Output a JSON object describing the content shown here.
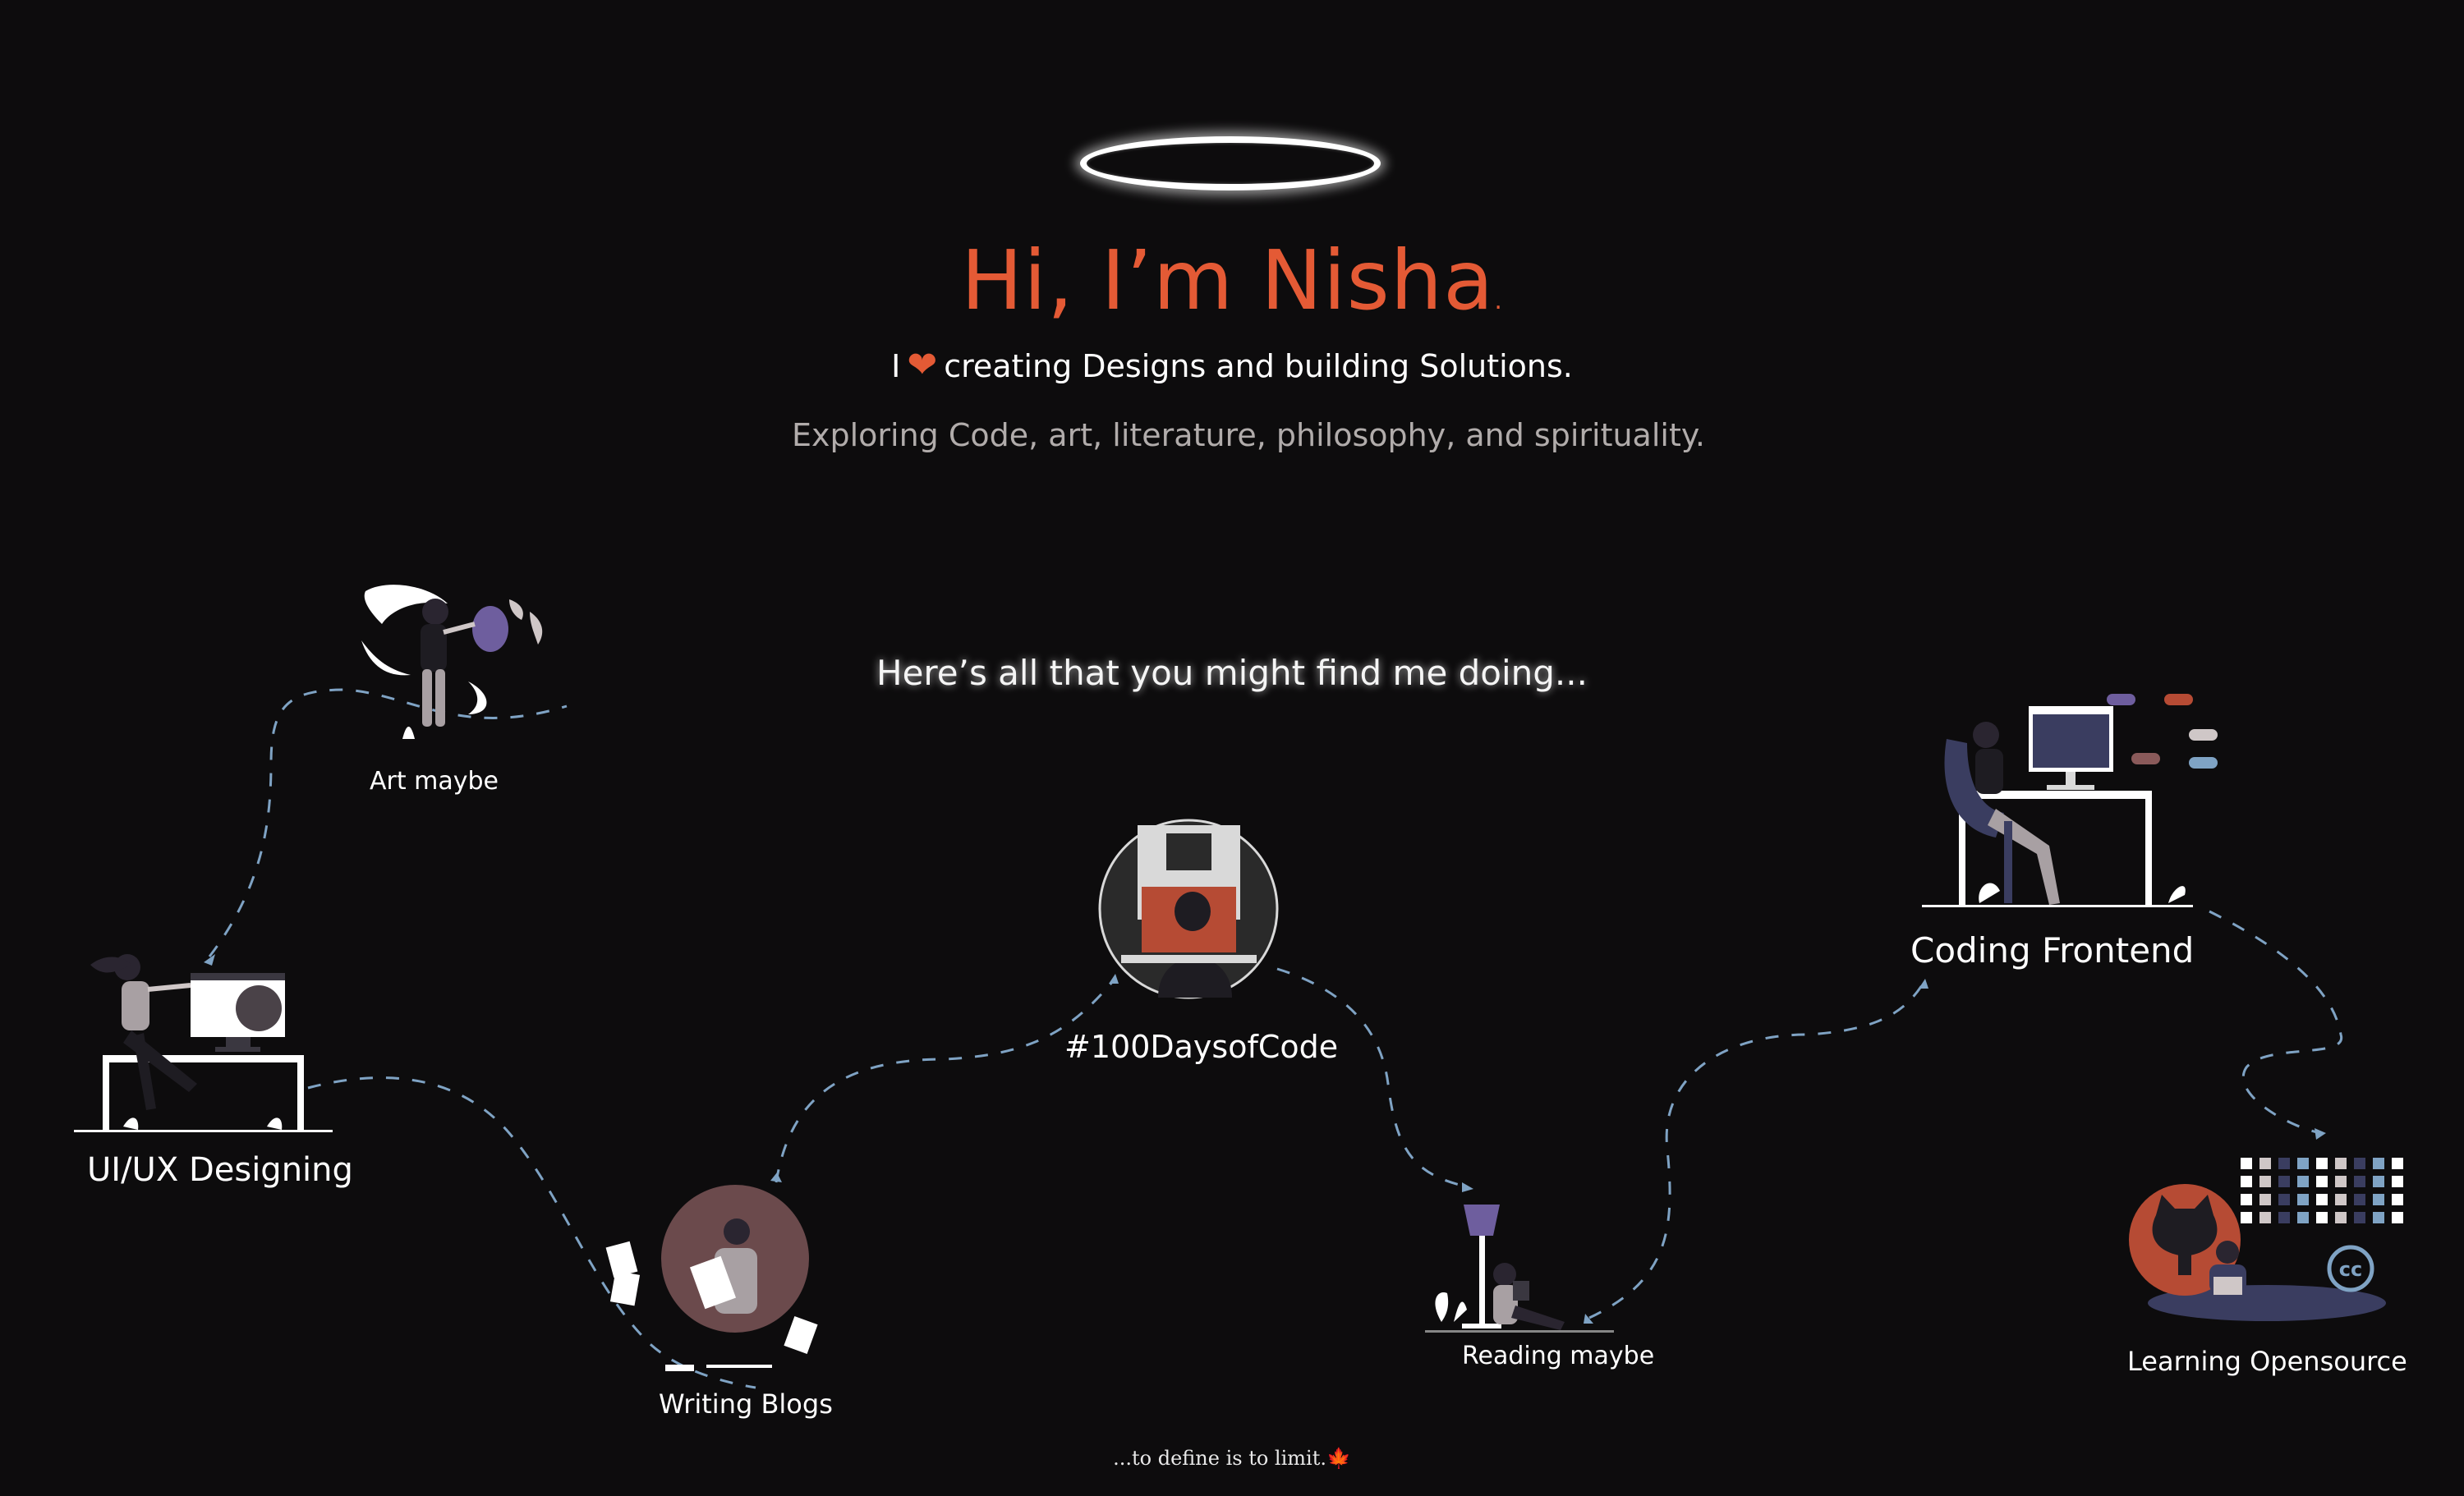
{
  "hero": {
    "greeting": "Hi, I’m Nisha",
    "greeting_dot": ".",
    "tagline_prefix": "I",
    "tagline_rest": "creating Designs and building Solutions.",
    "subline": "Exploring Code,  art, literature, philosophy, and  spirituality."
  },
  "section_heading": "Here’s all that you might find me doing...",
  "activities": [
    {
      "label": "Art maybe"
    },
    {
      "label": "UI/UX Designing"
    },
    {
      "label": "Writing Blogs"
    },
    {
      "label": "#100DaysofCode"
    },
    {
      "label": "Reading maybe"
    },
    {
      "label": "Coding Frontend"
    },
    {
      "label": "Learning Opensource"
    }
  ],
  "footer": {
    "quote": "...to define is to limit."
  },
  "icons": {
    "heart": "heart-icon",
    "leaf": "maple-leaf-icon",
    "creative_commons": "creative-commons-icon"
  },
  "colors": {
    "background": "#0d0c0d",
    "accent": "#e45a35",
    "path": "#7fa3c4",
    "muted_text": "#b1acab"
  }
}
